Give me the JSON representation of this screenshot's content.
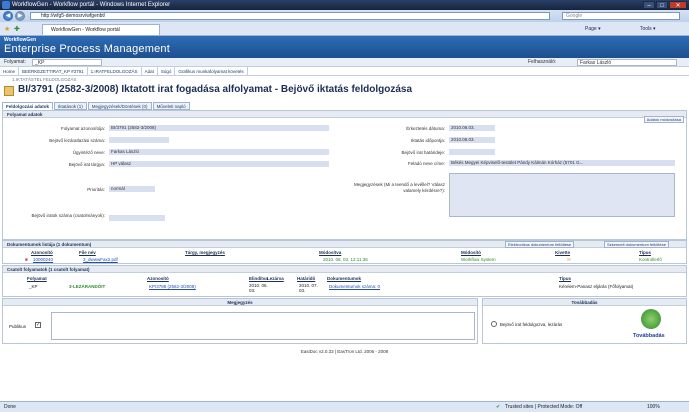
{
  "window": {
    "title": "WorkflowGen - Workflow portál - Windows Internet Explorer",
    "min": "–",
    "max": "□",
    "close": "✕"
  },
  "browser": {
    "url": "http://wfg5-demosrv/wfgenbt/",
    "search_placeholder": "Google",
    "tab_label": "WorkflowGen - Workflow portál",
    "tools": {
      "page": "Page ▾",
      "tools": "Tools ▾"
    }
  },
  "app": {
    "brand": "WorkflowGen",
    "title": "Enterprise Process Management"
  },
  "userbar": {
    "filter_label": "Folyamat:",
    "filter_value": "_KP",
    "user_label": "Felhasználó:",
    "user_value": "Farkas László"
  },
  "menu": [
    "Home",
    "BEÉRKEZETTIRAT_KP #3791",
    "1.IRATFELDOLGOZÁS",
    "Adat",
    "Súgó",
    "Grafikus munkafolyamat követés"
  ],
  "breadcrumb": "1.IKTATÁSTEL FELDOLGOZÁS",
  "doc_title": "BI/3791 (2582-3/2008) Iktatott irat fogadása alfolyamat - Bejövő iktatás feldolgozása",
  "subtabs": [
    "Feldolgozási adatok",
    "Iktatások (1)",
    "Megjegyzések/Döntések (0)",
    "Műveleti napló"
  ],
  "form": {
    "section": "Folyamat adatok",
    "history_btn": "Adatok módosítása",
    "left": [
      {
        "label": "Folyamat azonosítója:",
        "value": "BI/3791 (2582-3/2008)"
      },
      {
        "label": "Bejövő lezáratlazási száma:",
        "value": ""
      },
      {
        "label": "Ügyintéző neve:",
        "value": "Farkas László"
      },
      {
        "label": "Bejövő irat tárgya:",
        "value": "HP válasz"
      },
      {
        "label": "Prioritás:",
        "value": "normál"
      },
      {
        "label": "Bejövő iratok száma (csatolmányok):",
        "value": ""
      }
    ],
    "right": [
      {
        "label": "Érkeztetés dátuma:",
        "value": "2010.06.03."
      },
      {
        "label": "Iktatás időpontja:",
        "value": "2010.06.03."
      },
      {
        "label": "Bejövő irat határideje:",
        "value": ""
      },
      {
        "label": "Feladó neve címe:",
        "value": "Békés Megyei Képviselő-testület Pándy Kálmán Kórház (5701 G..."
      },
      {
        "label": "Megjegyzések (Mi a teendő a levéllel? Válasz valamely kérdésre?):",
        "value": ""
      }
    ]
  },
  "documents": {
    "section": "Dokumentumok listája (1 dokumentum)",
    "btn_electronic": "Elektronikus dokumentum feltöltése",
    "btn_paper": "Szkennelt dokumentum feltöltése",
    "headers": [
      "Azonosító",
      "File név",
      "Tárgy, megjegyzés",
      "Módosítva",
      "Módosító",
      "Kivette",
      "Típus"
    ],
    "rows": [
      {
        "id": "10000240",
        "file": "3_dwwwFax2.pdf",
        "subject": "",
        "modified": "2010. 06. 03. 12:11:36",
        "modifier": "Workflow System",
        "taken": "",
        "type": "Kontrollerlõ"
      }
    ]
  },
  "linked": {
    "section": "Csatolt folyamatok (1 csatolt folyamat)",
    "headers": [
      "Folyamat",
      "Azonosító",
      "Elindítva",
      "Lezárva",
      "Határidő",
      "Dokumentumok",
      "Típus"
    ],
    "rows": [
      {
        "process": "_KP",
        "status": "3-LEZÁRANDÓIT",
        "id": "KP/3788 (2582-3/2008)",
        "started": "2010. 06. 03.",
        "closed": "",
        "deadline": "2010. 07. 03.",
        "docs": "Dokumentumok száma: 0",
        "type": "Kérelem-Panasz eljárás (Főfolyamat)"
      }
    ]
  },
  "comment": {
    "title": "Megjegyzés",
    "public_label": "Publikus"
  },
  "forward": {
    "title": "Továbbadás",
    "option": "Bejövő irat feldolgozva, lezárás",
    "button": "Továbbadás"
  },
  "footer": "EasiDoc v2.0.33  |  EasTron Ltd. 2006 - 2008",
  "status": {
    "left": "Done",
    "zone": "Trusted sites | Protected Mode: Off",
    "zoom": "100%"
  }
}
